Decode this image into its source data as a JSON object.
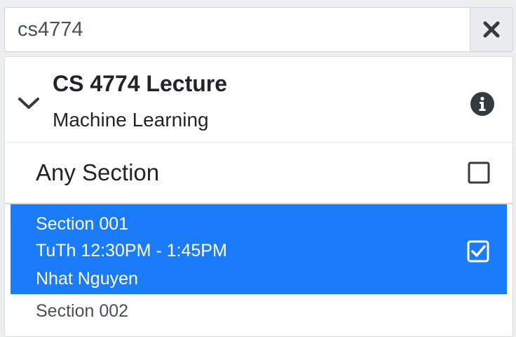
{
  "search": {
    "value": "cs4774",
    "clear_icon": "close-icon"
  },
  "course": {
    "title": "CS 4774 Lecture",
    "subtitle": "Machine Learning",
    "expand_icon": "chevron-down-icon",
    "info_icon": "info-circle-icon"
  },
  "any_section": {
    "label": "Any Section",
    "checked": false
  },
  "sections": [
    {
      "name": "Section 001",
      "time": "TuTh 12:30PM - 1:45PM",
      "instructor": "Nhat Nguyen",
      "checked": true,
      "highlight_color": "#1a7bfb"
    },
    {
      "name": "Section 002"
    }
  ]
}
